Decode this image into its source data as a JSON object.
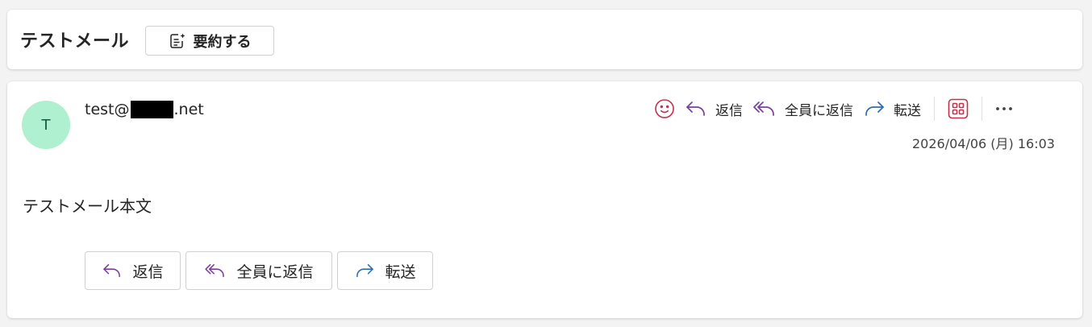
{
  "subject": {
    "title": "テストメール",
    "summarize_label": "要約する"
  },
  "message": {
    "avatar_initial": "T",
    "sender_prefix": "test@",
    "sender_suffix": ".net",
    "timestamp": "2026/04/06 (月) 16:03",
    "body": "テストメール本文"
  },
  "toolbar": {
    "reply_label": "返信",
    "reply_all_label": "全員に返信",
    "forward_label": "転送"
  },
  "bottom_actions": {
    "reply_label": "返信",
    "reply_all_label": "全員に返信",
    "forward_label": "転送"
  },
  "colors": {
    "avatar_bg": "#aef0d0",
    "reply_icon": "#7a3e9d",
    "forward_icon": "#2b6cb0",
    "emoji_icon": "#c4314b",
    "apps_icon": "#c4314b"
  },
  "icons": [
    "summary-icon",
    "emoji-icon",
    "reply-icon",
    "reply-all-icon",
    "forward-icon",
    "apps-icon",
    "more-icon"
  ]
}
